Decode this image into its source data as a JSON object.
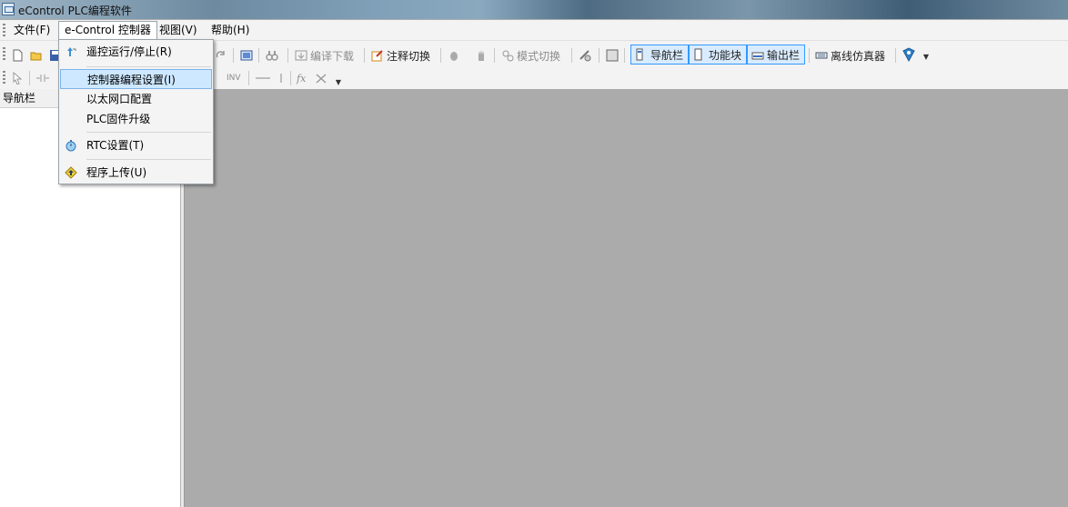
{
  "window": {
    "title": "eControl PLC编程软件"
  },
  "menubar": {
    "items": [
      {
        "label": "文件(F)"
      },
      {
        "label": "e-Control 控制器"
      },
      {
        "label": "视图(V)"
      },
      {
        "label": "帮助(H)"
      }
    ]
  },
  "toolbar1": {
    "compile_download": "编译下载",
    "comment_toggle": "注释切换",
    "mode_switch": "模式切换",
    "nav_bar": "导航栏",
    "function_block": "功能块",
    "output_bar": "输出栏",
    "offline_sim": "离线仿真器"
  },
  "toolbar2": {
    "inv_label": "INV",
    "fx_label": "fx"
  },
  "navpanel": {
    "title": "导航栏"
  },
  "dropdown": {
    "items": [
      {
        "label": "遥控运行/停止(R)"
      },
      {
        "label": "控制器编程设置(I)"
      },
      {
        "label": "以太网口配置"
      },
      {
        "label": "PLC固件升级"
      },
      {
        "label": "RTC设置(T)"
      },
      {
        "label": "程序上传(U)"
      }
    ]
  },
  "colors": {
    "highlight": "#cde8ff",
    "toggle_border": "#3399ff",
    "workspace": "#ababab"
  }
}
